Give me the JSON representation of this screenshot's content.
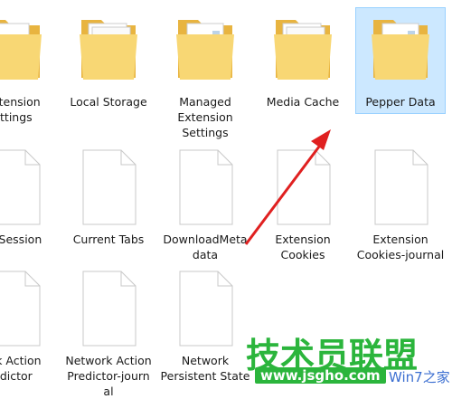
{
  "files": [
    {
      "label": "Extension\nettings",
      "type": "folder"
    },
    {
      "label": "Local Storage",
      "type": "folder"
    },
    {
      "label": "Managed\nExtension\nSettings",
      "type": "folder"
    },
    {
      "label": "Media Cache",
      "type": "folder"
    },
    {
      "label": "Pepper Data",
      "type": "folder",
      "selected": true
    },
    {
      "label": "nt Session",
      "type": "file"
    },
    {
      "label": "Current Tabs",
      "type": "file"
    },
    {
      "label": "DownloadMeta\ndata",
      "type": "file"
    },
    {
      "label": "Extension\nCookies",
      "type": "file"
    },
    {
      "label": "Extension\nCookies-journal",
      "type": "file"
    },
    {
      "label": "ork Action\nedictor",
      "type": "file"
    },
    {
      "label": "Network Action\nPredictor-journ\nal",
      "type": "file"
    },
    {
      "label": "Network\nPersistent State",
      "type": "file"
    }
  ],
  "watermark": {
    "title": "技术员联盟",
    "url": "www.jsgho.com",
    "small": "Win7之家"
  },
  "colors": {
    "selection": "#cce8ff",
    "folder": "#f5c95a",
    "arrow": "#e02020",
    "watermark": "#2bb53c"
  }
}
